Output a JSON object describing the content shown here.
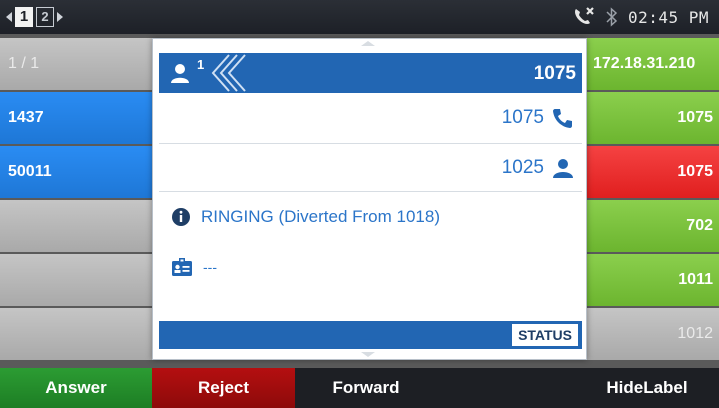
{
  "statusbar": {
    "pages": [
      "1",
      "2"
    ],
    "time": "02:45 PM",
    "icons": [
      "missed-call-icon",
      "bluetooth-icon"
    ]
  },
  "left_column": [
    "1 / 1",
    "1437",
    "50011",
    "",
    "",
    ""
  ],
  "right_column": [
    "172.18.31.210",
    "1075",
    "1075",
    "702",
    "1011",
    "1012"
  ],
  "popup": {
    "line_number": "1",
    "header_number": "1075",
    "caller_number": "1075",
    "callee_number": "1025",
    "status_text": "RINGING (Diverted From 1018)",
    "contact_text": "---",
    "status_label": "STATUS"
  },
  "softkeys": {
    "answer": "Answer",
    "reject": "Reject",
    "forward": "Forward",
    "hide_label": "HideLabel"
  },
  "colors": {
    "accent_blue": "#2266b3",
    "text_blue": "#2b75c9",
    "answer_green": "#1d7e24",
    "reject_red": "#b40f10",
    "line_green": "#6cb52f",
    "line_red": "#e01f1f",
    "line_blue": "#1e77d6"
  }
}
